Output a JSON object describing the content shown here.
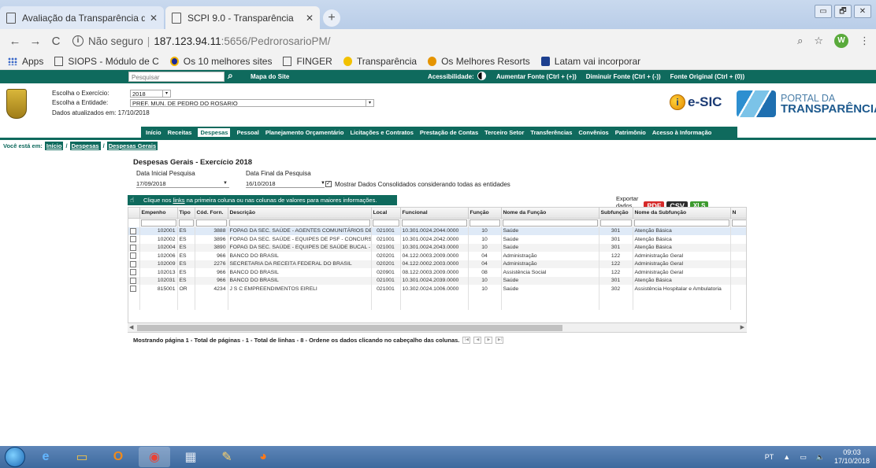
{
  "browser": {
    "tabs": [
      {
        "title": "Avaliação da Transparência dos M",
        "close": "✕"
      },
      {
        "title": "SCPI 9.0 - Transparência",
        "close": "✕"
      }
    ],
    "new_tab": "+",
    "window_buttons": [
      "▭",
      "🗗",
      "✕"
    ],
    "address": {
      "security": "Não seguro",
      "host": "187.123.94.11",
      "path": ":5656/PedrorosarioPM/"
    },
    "avatar_letter": "W",
    "bookmarks": [
      {
        "label": "Apps",
        "icon": "apps-grid-icon"
      },
      {
        "label": "SIOPS - Módulo de C",
        "icon": "document-icon"
      },
      {
        "label": "Os 10 melhores sites",
        "icon": "circle-logo-icon"
      },
      {
        "label": "FINGER",
        "icon": "document-icon"
      },
      {
        "label": "Transparência",
        "icon": "info-coin-icon"
      },
      {
        "label": "Os Melhores Resorts",
        "icon": "resort-icon"
      },
      {
        "label": "Latam vai incorporar",
        "icon": "news-icon"
      }
    ]
  },
  "site": {
    "search_placeholder": "Pesquisar",
    "mapa": "Mapa do Site",
    "acessibilidade": "Acessibilidade:",
    "font_links": [
      "Aumentar Fonte (Ctrl + (+))",
      "Diminuir Fonte (Ctrl + (-))",
      "Fonte Original (Ctrl + (0))"
    ],
    "exercicio_label": "Escolha o Exercício:",
    "exercicio_value": "2018",
    "entidade_label": "Escolha a Entidade:",
    "entidade_value": "PREF. MUN. DE PEDRO DO ROSARIO",
    "atualizados": "Dados atualizados em: 17/10/2018",
    "esic": "e-SIC",
    "portal_line1": "PORTAL DA",
    "portal_line2": "TRANSPARÊNCIA",
    "nav": [
      "Início",
      "Receitas",
      "Despesas",
      "Pessoal",
      "Planejamento Orçamentário",
      "Licitações e Contratos",
      "Prestação de Contas",
      "Terceiro Setor",
      "Transferências",
      "Convênios",
      "Patrimônio",
      "Acesso à Informação"
    ],
    "breadcrumb_label": "Você está em:",
    "breadcrumb": [
      "Início",
      "Despesas",
      "Despesas Gerais"
    ],
    "breadcrumb_sep": "/"
  },
  "content": {
    "title": "Despesas Gerais - Exercício 2018",
    "data_inicial_label": "Data Inicial Pesquisa",
    "data_inicial": "17/09/2018",
    "data_final_label": "Data Final da Pesquisa",
    "data_final": "16/10/2018",
    "consolidados_label": "Mostrar Dados Consolidados considerando todas as entidades",
    "hint_pre": "Clique nos ",
    "hint_link": "links",
    "hint_post": " na primeira coluna ou nas colunas de valores para maiores informações.",
    "export_label": "Exportar dados para:",
    "export_buttons": [
      "PDF",
      "CSV",
      "XLS"
    ],
    "columns": [
      "",
      "Empenho",
      "Tipo",
      "Cód. Forn.",
      "Descrição",
      "Local",
      "Funcional",
      "Função",
      "Nome da Função",
      "Subfunção",
      "Nome da Subfunção",
      "N"
    ],
    "rows": [
      [
        "102001",
        "ES",
        "3888",
        "FOPAG DA SEC. SAÚDE - AGENTES COMUNITÁRIOS DE",
        "021001",
        "10.301.0024.2044.0000",
        "10",
        "Saúde",
        "301",
        "Atenção Básica"
      ],
      [
        "102002",
        "ES",
        "3896",
        "FOPAG DA SEC. SAÚDE - EQUIPES DE PSF - CONCURSA",
        "021001",
        "10.301.0024.2042.0000",
        "10",
        "Saúde",
        "301",
        "Atenção Básica"
      ],
      [
        "102004",
        "ES",
        "3890",
        "FOPAG DA SEC. SAÚDE - EQUIPES DE SAÚDE BUCAL - (",
        "021001",
        "10.301.0024.2043.0000",
        "10",
        "Saúde",
        "301",
        "Atenção Básica"
      ],
      [
        "102006",
        "ES",
        "966",
        "BANCO DO BRASIL",
        "020201",
        "04.122.0003.2009.0000",
        "04",
        "Administração",
        "122",
        "Administração Geral"
      ],
      [
        "102009",
        "ES",
        "2276",
        "SECRETARIA DA RECEITA FEDERAL DO BRASIL",
        "020201",
        "04.122.0002.2003.0000",
        "04",
        "Administração",
        "122",
        "Administração Geral"
      ],
      [
        "102013",
        "ES",
        "966",
        "BANCO DO BRASIL",
        "020901",
        "08.122.0003.2009.0000",
        "08",
        "Assistência Social",
        "122",
        "Administração Geral"
      ],
      [
        "102031",
        "ES",
        "966",
        "BANCO DO BRASIL",
        "021001",
        "10.301.0024.2039.0000",
        "10",
        "Saúde",
        "301",
        "Atenção Básica"
      ],
      [
        "815001",
        "OR",
        "4234",
        "J S C EMPREENDIMENTOS EIRELI",
        "021001",
        "10.302.0024.1006.0000",
        "10",
        "Saúde",
        "302",
        "Assistência Hospitalar e Ambulatoria"
      ]
    ],
    "footer": "Mostrando página 1 - Total de páginas - 1 - Total de linhas - 8 - Ordene os dados clicando no cabeçalho das colunas."
  },
  "taskbar": {
    "lang": "PT",
    "time": "09:03",
    "date": "17/10/2018"
  }
}
